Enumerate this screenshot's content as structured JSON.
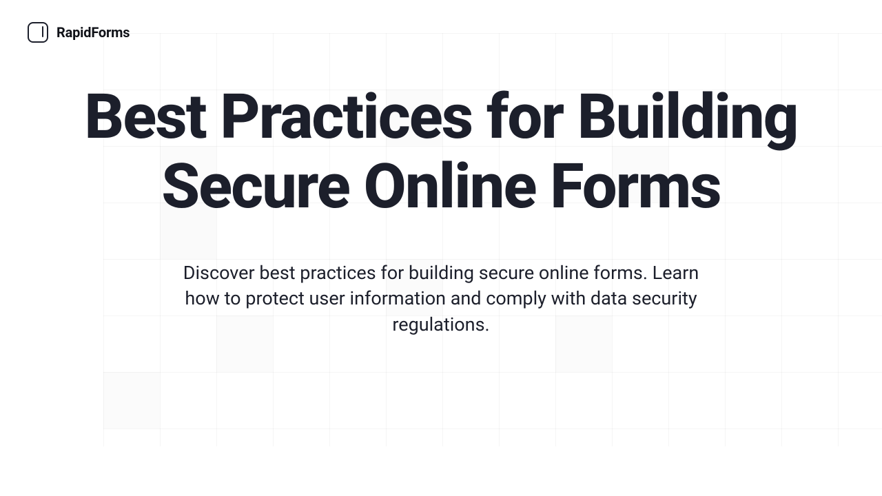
{
  "brand": {
    "name": "RapidForms"
  },
  "hero": {
    "title": "Best Practices for Building Secure Online Forms",
    "subtitle": "Discover best practices for building secure online forms. Learn how to protect user information and comply with data security regulations."
  }
}
